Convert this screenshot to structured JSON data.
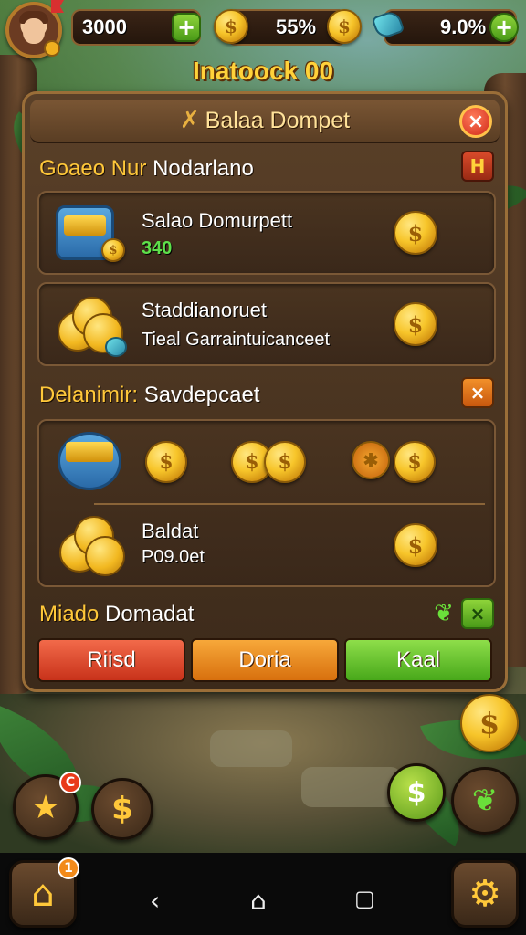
{
  "hud": {
    "coins": "3000",
    "progress": "55%",
    "gems": "9.0%"
  },
  "inventory_title": "Inatoock 00",
  "panel": {
    "title": "Balaa Dompet",
    "close_label": "×"
  },
  "section1": {
    "label_gold": "Goaeo Nur",
    "label_white": "Nodarlano",
    "button": "H",
    "items": [
      {
        "name": "Salao Domurpett",
        "value": "340"
      },
      {
        "name": "Staddianoruet",
        "desc": "Tieal Garraintuicanceet"
      }
    ]
  },
  "section2": {
    "label_gold": "Delanimir:",
    "label_white": "Savdepcaet",
    "button": "×",
    "items": [
      {
        "name": "Baldat",
        "value": "P09.0et"
      }
    ]
  },
  "section3": {
    "label_gold": "Miado",
    "label_white": "Domadat",
    "button": "×"
  },
  "actions": {
    "red": "Riisd",
    "orange": "Doria",
    "green": "Kaal"
  },
  "badges": {
    "quest": "C",
    "home": "1"
  },
  "icons": {
    "coin_symbol": "$",
    "home": "home-icon",
    "gear": "gear-icon"
  }
}
